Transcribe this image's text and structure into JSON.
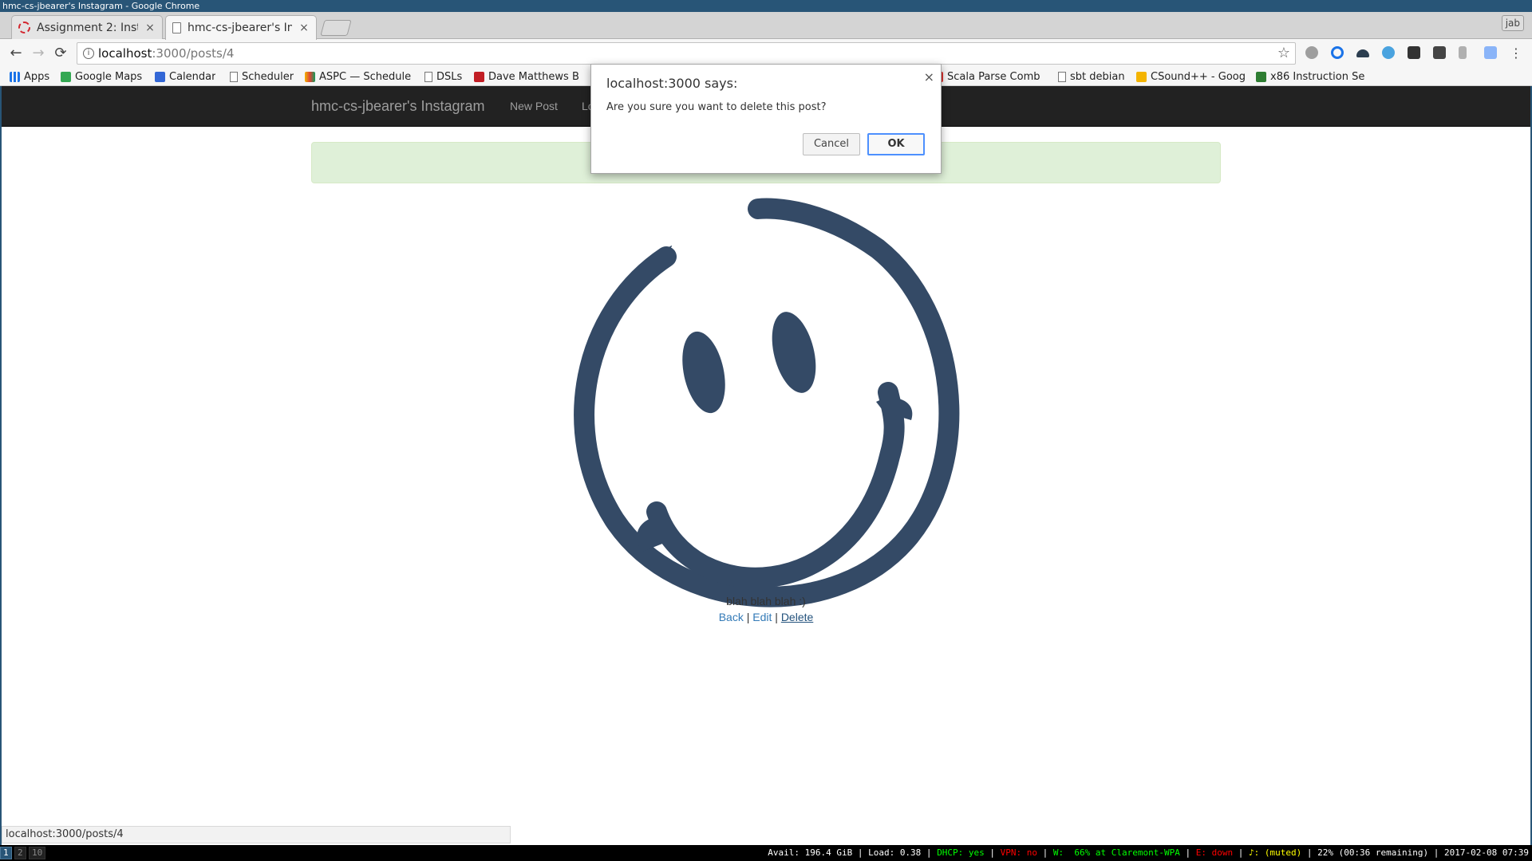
{
  "window": {
    "title": "hmc-cs-jbearer's Instagram - Google Chrome",
    "user_badge": "jab"
  },
  "tabs": [
    {
      "label": "Assignment 2: Insta",
      "close": "×"
    },
    {
      "label": "hmc-cs-jbearer's Ins",
      "close": "×"
    }
  ],
  "toolbar": {
    "back": "←",
    "forward": "→",
    "reload": "⟳",
    "info": "i",
    "star": "☆",
    "url_host": "localhost",
    "url_path": ":3000/posts/4",
    "menu": "⋮"
  },
  "bookmarks": [
    {
      "label": "Apps",
      "icon": "apps-grid-icon",
      "color": "#1a73e8"
    },
    {
      "label": "Google Maps",
      "icon": "maps-icon",
      "color": "#34a853"
    },
    {
      "label": "Calendar",
      "icon": "calendar-icon",
      "color": "#3367d6",
      "badge": "24"
    },
    {
      "label": "Scheduler",
      "icon": "page-icon"
    },
    {
      "label": "ASPC — Schedule",
      "icon": "aspc-icon",
      "color": "#f4b400"
    },
    {
      "label": "DSLs",
      "icon": "page-icon"
    },
    {
      "label": "Dave Matthews B",
      "icon": "music-icon",
      "color": "#c21e25"
    },
    {
      "label": "Scala Parse Comb",
      "icon": "scala-icon",
      "color": "#dc322f"
    },
    {
      "label": "sbt debian",
      "icon": "page-icon"
    },
    {
      "label": "CSound++ - Goog",
      "icon": "slides-icon",
      "color": "#f4b400"
    },
    {
      "label": "x86 Instruction Se",
      "icon": "x86-icon",
      "color": "#2e7d32"
    }
  ],
  "page": {
    "brand": "hmc-cs-jbearer's Instagram",
    "nav": [
      "New Post",
      "Lo"
    ],
    "caption": "blah blah blah :)",
    "links": {
      "back": "Back",
      "edit": "Edit",
      "delete": "Delete",
      "sep": "|"
    },
    "status_url": "localhost:3000/posts/4"
  },
  "dialog": {
    "title": "localhost:3000 says:",
    "message": "Are you sure you want to delete this post?",
    "cancel": "Cancel",
    "ok": "OK",
    "close": "×"
  },
  "i3bar": {
    "workspaces": [
      "1",
      "2",
      "10"
    ],
    "status": [
      {
        "text": "Avail: 196.4 GiB",
        "color": "#ffffff"
      },
      {
        "text": " | ",
        "color": "#ffffff"
      },
      {
        "text": "Load: 0.38",
        "color": "#ffffff"
      },
      {
        "text": " | ",
        "color": "#ffffff"
      },
      {
        "text": "DHCP: yes",
        "color": "#00ff00"
      },
      {
        "text": " | ",
        "color": "#ffffff"
      },
      {
        "text": "VPN: no",
        "color": "#ff0000"
      },
      {
        "text": " | ",
        "color": "#ffffff"
      },
      {
        "text": "W:  66% at Claremont-WPA",
        "color": "#00ff00"
      },
      {
        "text": " | ",
        "color": "#ffffff"
      },
      {
        "text": "E: down",
        "color": "#ff0000"
      },
      {
        "text": " | ",
        "color": "#ffffff"
      },
      {
        "text": "♪: (muted)",
        "color": "#ffff00"
      },
      {
        "text": " | ",
        "color": "#ffffff"
      },
      {
        "text": "22% (00:36 remaining)",
        "color": "#ffffff"
      },
      {
        "text": " | ",
        "color": "#ffffff"
      },
      {
        "text": "2017-02-08 07:39",
        "color": "#ffffff"
      }
    ]
  }
}
